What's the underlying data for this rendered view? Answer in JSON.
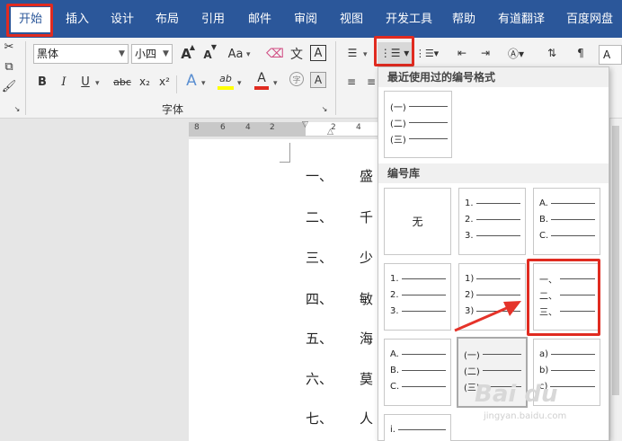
{
  "tabs": [
    "开始",
    "插入",
    "设计",
    "布局",
    "引用",
    "邮件",
    "审阅",
    "视图",
    "开发工具",
    "帮助",
    "有道翻译",
    "百度网盘"
  ],
  "font": {
    "name": "黑体",
    "size": "小四",
    "grow_icon": "A",
    "shrink_icon": "A",
    "case_label": "Aa",
    "char_shade": "A",
    "group_label": "字体"
  },
  "format_buttons": {
    "bold": "B",
    "italic": "I",
    "underline": "U",
    "strike": "abc",
    "sub": "x₂",
    "sup": "x²"
  },
  "char_glyphs": {
    "effect": "A",
    "highlight": "ab",
    "fontcolor": "A",
    "circle": "字"
  },
  "ruler": [
    "8",
    "6",
    "4",
    "2",
    "2",
    "4"
  ],
  "document_lines": [
    {
      "num": "一、",
      "text": "盛"
    },
    {
      "num": "二、",
      "text": "千"
    },
    {
      "num": "三、",
      "text": "少"
    },
    {
      "num": "四、",
      "text": "敏"
    },
    {
      "num": "五、",
      "text": "海"
    },
    {
      "num": "六、",
      "text": "莫"
    },
    {
      "num": "七、",
      "text": "人"
    }
  ],
  "dropdown": {
    "recent_header": "最近使用过的编号格式",
    "recent": [
      "(一)",
      "(二)",
      "(三)"
    ],
    "library_header": "编号库",
    "none_label": "无",
    "tiles": [
      [
        "1.",
        "2.",
        "3."
      ],
      [
        "A.",
        "B.",
        "C."
      ],
      [
        "1.",
        "2.",
        "3."
      ],
      [
        "1)",
        "2)",
        "3)"
      ],
      [
        "一、",
        "二、",
        "三、"
      ],
      [
        "A.",
        "B.",
        "C."
      ],
      [
        "(一)",
        "(二)",
        "(三)"
      ],
      [
        "a)",
        "b)",
        "c)"
      ],
      [
        "i."
      ]
    ]
  },
  "watermark": {
    "logo": "Bai du",
    "url": "jingyan.baidu.com"
  },
  "colors": {
    "brand": "#2b579a",
    "highlight_red": "#e02b20",
    "arrow_red": "#e5332a",
    "text_highlight": "#ffff00",
    "font_red": "#e02b20"
  }
}
